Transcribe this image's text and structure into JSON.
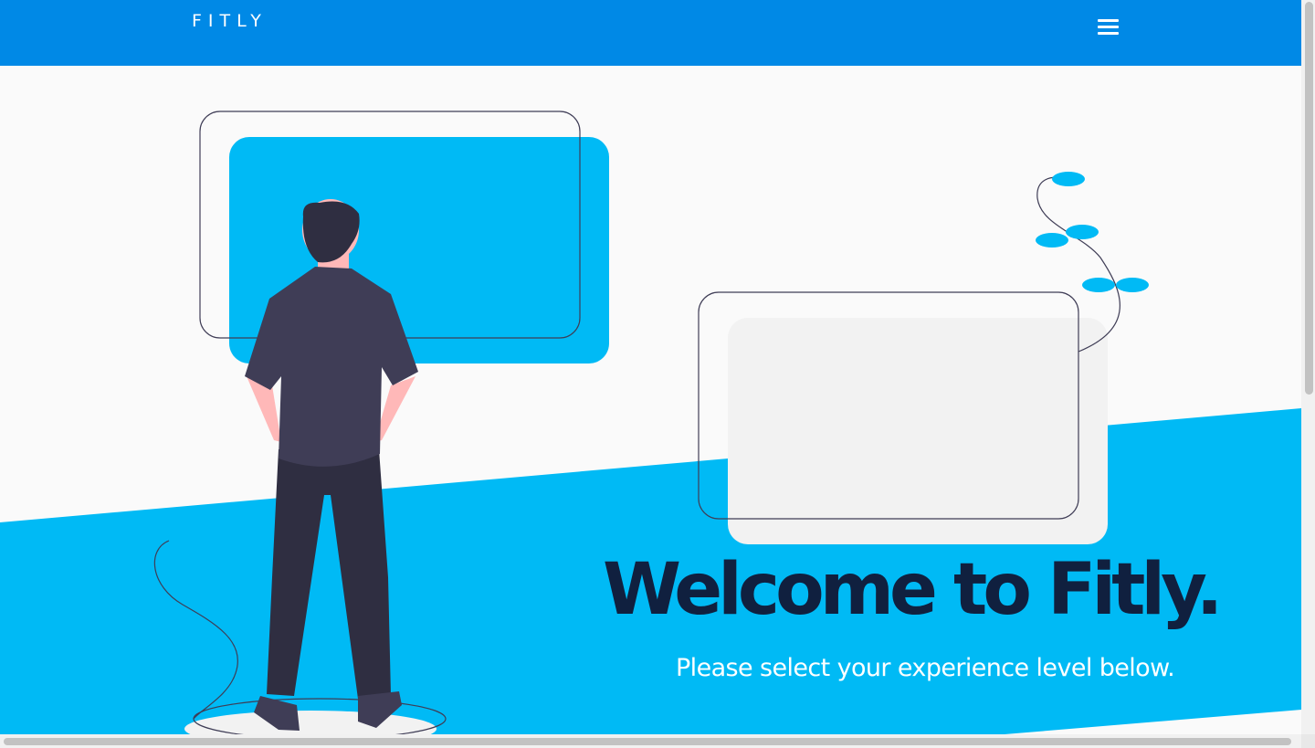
{
  "navbar": {
    "brand": "FITLY",
    "menu_icon": "hamburger-menu-icon"
  },
  "hero": {
    "title": "Welcome to Fitly.",
    "subtitle": "Please select your experience level below.",
    "illustration": "person-viewing-screens-illustration"
  },
  "colors": {
    "navbar": "#0089e6",
    "accent": "#00baf5",
    "title": "#10203f",
    "background": "#fafafa"
  }
}
